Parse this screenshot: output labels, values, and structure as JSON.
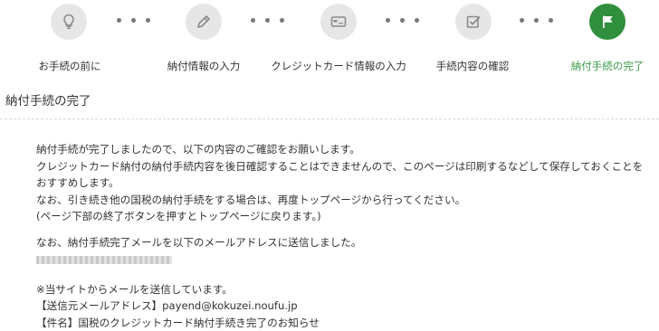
{
  "steps": [
    {
      "label": "お手続の前に",
      "icon": "lightbulb-icon",
      "status": "done"
    },
    {
      "label": "納付情報の入力",
      "icon": "pencil-icon",
      "status": "done"
    },
    {
      "label": "クレジットカード情報の入力",
      "icon": "credit-card-icon",
      "status": "done"
    },
    {
      "label": "手続内容の確認",
      "icon": "checkbox-icon",
      "status": "done"
    },
    {
      "label": "納付手続の完了",
      "icon": "flag-icon",
      "status": "current"
    }
  ],
  "colors": {
    "active": "#2f8f3c",
    "active_text": "#3a9a47",
    "inactive_circle": "#e6e6e6",
    "icon_gray": "#8a8a8a"
  },
  "page_title": "納付手続の完了",
  "message": {
    "line1": "納付手続が完了しましたので、以下の内容のご確認をお願いします。",
    "line2": "クレジットカード納付の納付手続内容を後日確認することはできませんので、このページは印刷するなどして保存しておくことを",
    "line3": "おすすめします。",
    "line4": "なお、引き続き他の国税の納付手続をする場合は、再度トップページから行ってください。",
    "line5": "(ページ下部の終了ボタンを押すとトップページに戻ります。)",
    "line6": "なお、納付手続完了メールを以下のメールアドレスに送信しました。",
    "line7": "※当サイトからメールを送信しています。",
    "line8": "【送信元メールアドレス】payend@kokuzei.noufu.jp",
    "line9": "【件名】国税のクレジットカード納付手続き完了のお知らせ"
  }
}
